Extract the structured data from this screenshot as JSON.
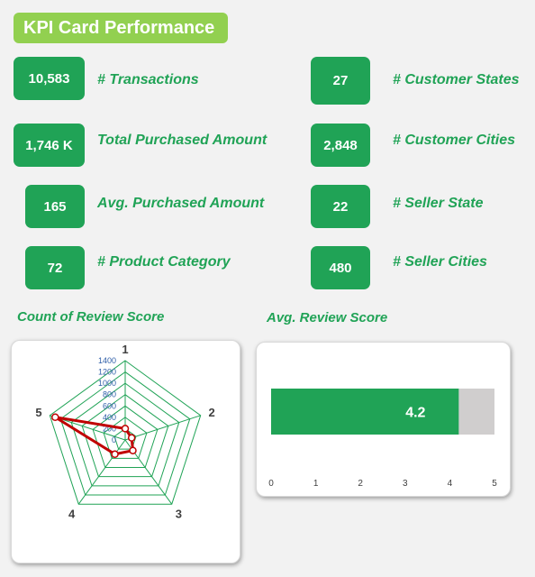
{
  "header": {
    "title": "KPI Card Performance"
  },
  "kpis": [
    {
      "value": "10,583",
      "label": "# Transactions"
    },
    {
      "value": "27",
      "label": "# Customer States"
    },
    {
      "value": "1,746 K",
      "label": "Total Purchased Amount"
    },
    {
      "value": "2,848",
      "label": "# Customer Cities"
    },
    {
      "value": "165",
      "label": "Avg. Purchased Amount"
    },
    {
      "value": "22",
      "label": "# Seller State"
    },
    {
      "value": "72",
      "label": "# Product Category"
    },
    {
      "value": "480",
      "label": "# Seller Cities"
    }
  ],
  "chart_data": [
    {
      "type": "radar",
      "title": "Count of Review Score",
      "categories": [
        "1",
        "2",
        "3",
        "4",
        "5"
      ],
      "values": [
        200,
        120,
        230,
        310,
        1300
      ],
      "radial_ticks": [
        "0",
        "200",
        "400",
        "600",
        "800",
        "1000",
        "1200",
        "1400"
      ],
      "rlim": [
        0,
        1400
      ],
      "colors": {
        "series": "#c00000",
        "grid": "#20a356",
        "ticks": "#2e5ea8"
      }
    },
    {
      "type": "bar",
      "orientation": "horizontal",
      "title": "Avg. Review Score",
      "values": [
        4.2
      ],
      "data_labels": [
        "4.2"
      ],
      "xlim": [
        0,
        5
      ],
      "x_ticks": [
        "0",
        "1",
        "2",
        "3",
        "4",
        "5"
      ],
      "colors": {
        "bar": "#20a356",
        "background": "#d0cece"
      }
    }
  ]
}
